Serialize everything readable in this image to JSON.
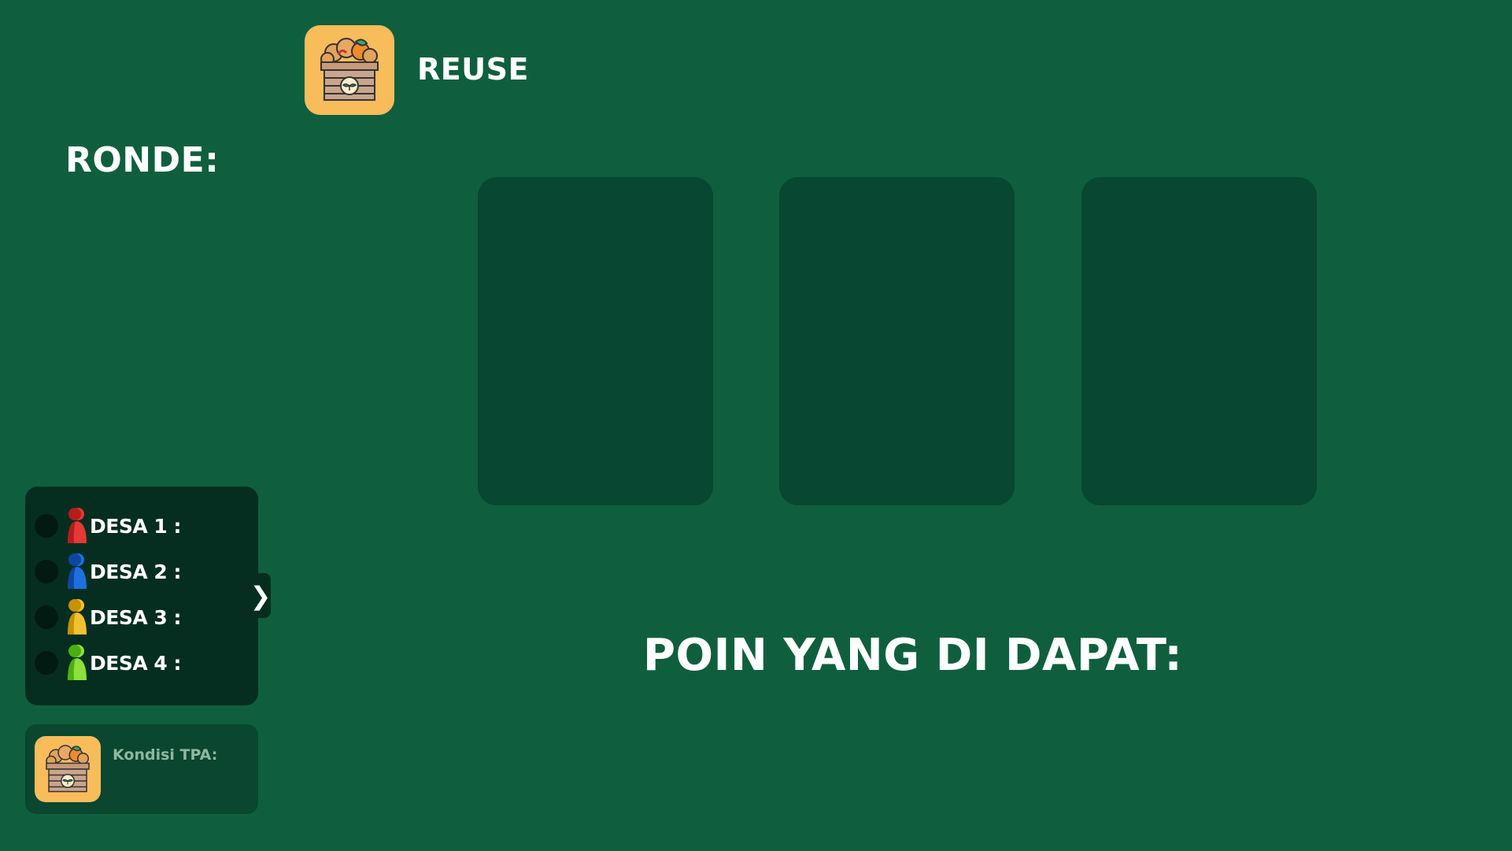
{
  "header": {
    "title": "REUSE",
    "icon": "compost-crate-icon"
  },
  "round": {
    "label": "RONDE:"
  },
  "cards": {
    "slots": [
      "card-slot-1",
      "card-slot-2",
      "card-slot-3"
    ]
  },
  "points": {
    "label": "POIN YANG DI DAPAT:"
  },
  "villages": {
    "items": [
      {
        "label": "DESA 1 :",
        "color": "#e53935"
      },
      {
        "label": "DESA 2 :",
        "color": "#1e6fe0"
      },
      {
        "label": "DESA 3 :",
        "color": "#e5b31f"
      },
      {
        "label": "DESA 4 :",
        "color": "#7ed321"
      }
    ],
    "collapse_symbol": "❯"
  },
  "tpa": {
    "label": "Kondisi TPA:",
    "icon": "compost-crate-icon"
  },
  "colors": {
    "background": "#0f5f3f",
    "card_slot": "#084731",
    "panel": "#052e20",
    "icon_bg": "#f9bc5b"
  }
}
